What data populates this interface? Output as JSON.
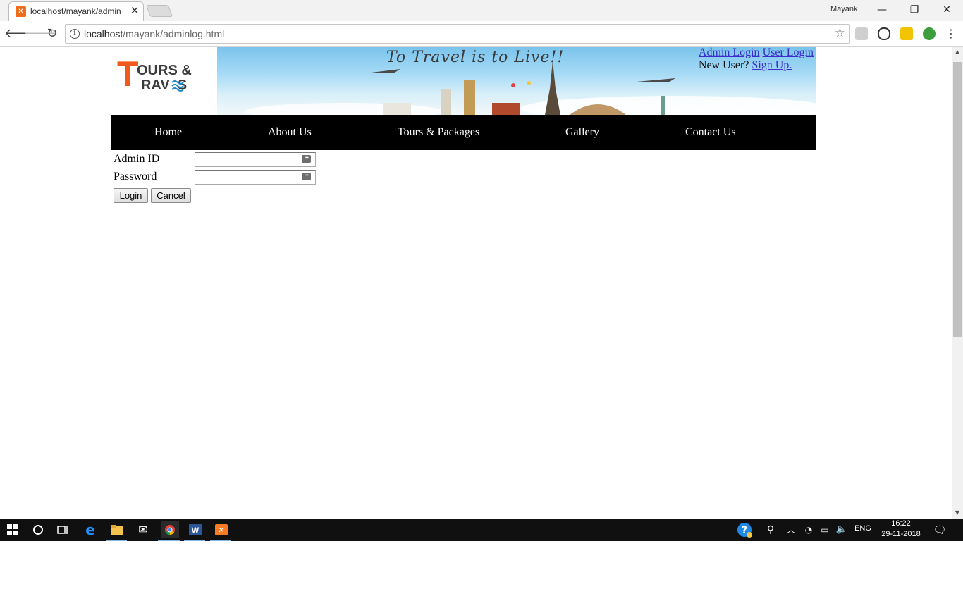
{
  "browser": {
    "tab_title": "localhost/mayank/admin",
    "tab_close": "✕",
    "profile_name": "Mayank",
    "url_host": "localhost",
    "url_path": "/mayank/adminlog.html",
    "window_buttons": {
      "minimize": "—",
      "maximize": "❐",
      "close": "✕"
    }
  },
  "header": {
    "logo_t": "T",
    "logo_ours": "OURS &",
    "logo_ravels": "RAV  S",
    "slogan": "To Travel is to Live!!",
    "admin_login": "Admin Login",
    "user_login": "User Login",
    "new_user_text": "New User?",
    "signup": "Sign Up."
  },
  "nav": {
    "items": [
      "Home",
      "About Us",
      "Tours & Packages",
      "Gallery",
      "Contact Us"
    ]
  },
  "form": {
    "admin_id_label": "Admin ID",
    "admin_id_value": "",
    "password_label": "Password",
    "password_value": "",
    "key_icon_text": "•••",
    "login_label": "Login",
    "cancel_label": "Cancel"
  },
  "taskbar": {
    "language": "ENG",
    "time": "16:22",
    "date": "29-11-2018"
  },
  "icons": {
    "back": "back-arrow-icon",
    "forward": "forward-arrow-icon",
    "reload": "reload-icon",
    "bookmark": "star-icon"
  },
  "colors": {
    "navbar": "#000000",
    "link": "#3a2dcc",
    "taskbar": "#101010"
  }
}
